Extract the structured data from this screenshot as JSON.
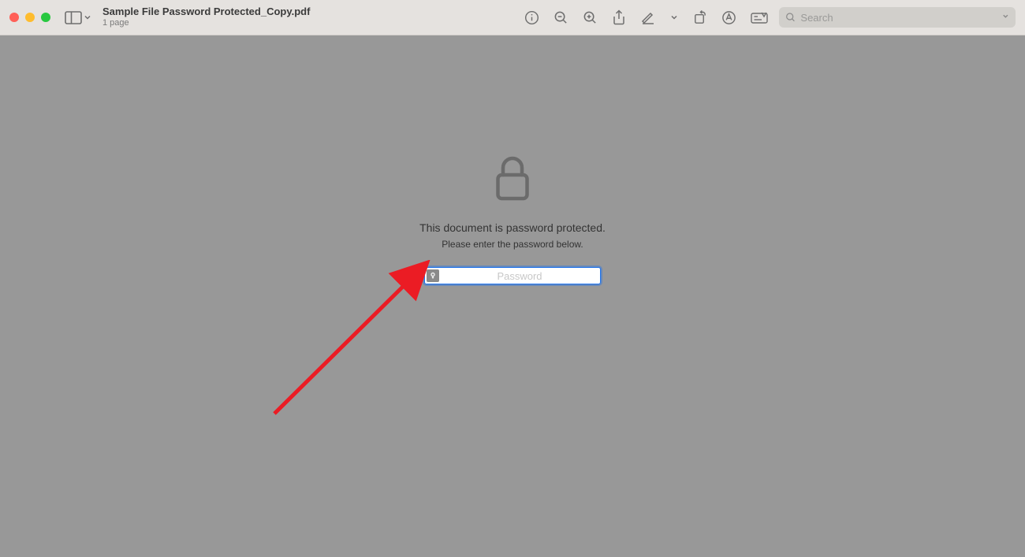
{
  "toolbar": {
    "filename": "Sample File Password Protected_Copy.pdf",
    "subtitle": "1 page",
    "search_placeholder": "Search"
  },
  "prompt": {
    "line1": "This document is password protected.",
    "line2": "Please enter the password below.",
    "password_placeholder": "Password"
  }
}
